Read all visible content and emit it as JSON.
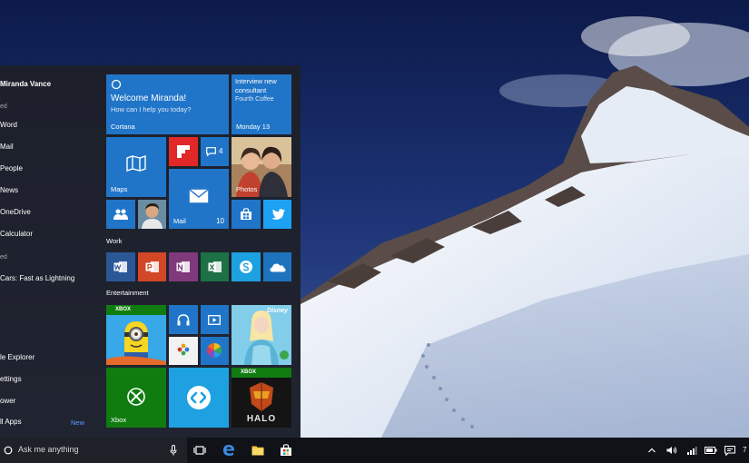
{
  "user": {
    "name": "Miranda Vance"
  },
  "left_pane": {
    "most_used_header": "ed",
    "most_used": [
      {
        "label": "Word"
      },
      {
        "label": "Mail"
      },
      {
        "label": "People"
      },
      {
        "label": "News"
      },
      {
        "label": "OneDrive"
      },
      {
        "label": "Calculator"
      }
    ],
    "recent_header": "ed",
    "recent": [
      {
        "label": "Cars: Fast as Lightning"
      }
    ],
    "bottom": [
      {
        "label": "le Explorer"
      },
      {
        "label": "ettings"
      },
      {
        "label": "ower"
      },
      {
        "label": "ll Apps"
      }
    ],
    "new_badge": "New"
  },
  "tiles": {
    "cortana": {
      "title": "Welcome Miranda!",
      "subtitle": "How can I help you today?",
      "label": "Cortana"
    },
    "calendar": {
      "event": "Interview new consultant",
      "location": "Fourth Coffee",
      "date": "Monday 13"
    },
    "flipboard": {
      "icon": "flipboard-icon"
    },
    "messaging": {
      "count": "4"
    },
    "maps": {
      "label": "Maps"
    },
    "photos": {
      "label": "Photos"
    },
    "mail": {
      "label": "Mail",
      "count": "10"
    },
    "people": {
      "icon": "people-icon"
    },
    "store": {
      "icon": "store-icon"
    },
    "twitter": {
      "icon": "twitter-icon"
    },
    "xbox": {
      "badge": "XBOX",
      "label": "Xbox"
    },
    "minions": {
      "badge": "XBOX"
    },
    "frozen": {
      "badge": "Disney"
    },
    "halo": {
      "badge": "XBOX",
      "logo_text": "HALO"
    }
  },
  "groups": {
    "work": "Work",
    "entertainment": "Entertainment"
  },
  "taskbar": {
    "search_placeholder": "Ask me anything",
    "clock_partial": "7"
  },
  "colors": {
    "accent": "#1e73be",
    "office_word": "#2b5797",
    "office_powerpoint": "#d24726",
    "office_onenote": "#80397b",
    "office_excel": "#1e7145",
    "skype": "#1da1e0",
    "onedrive": "#1e73be",
    "xbox_green": "#107c10"
  }
}
